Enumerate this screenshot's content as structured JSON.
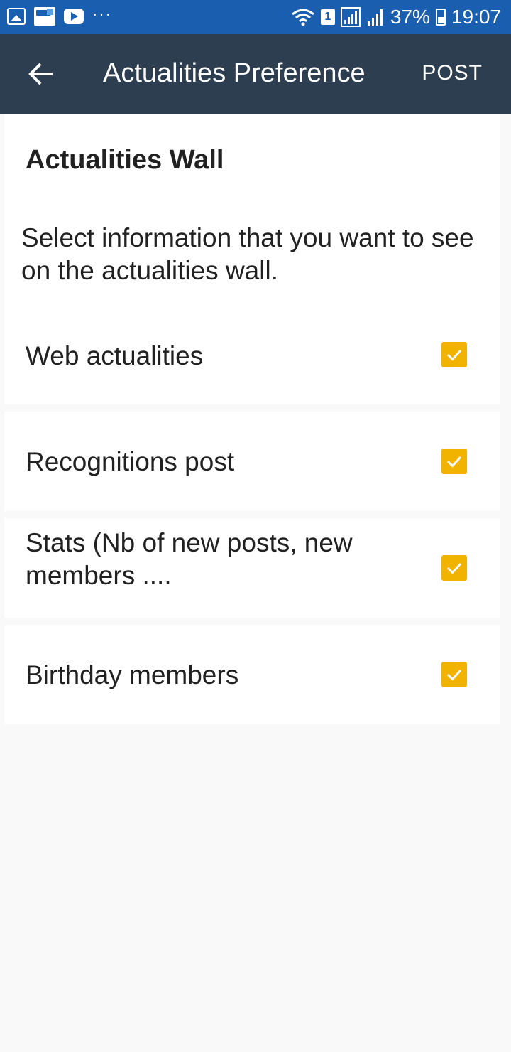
{
  "status_bar": {
    "icons_left": [
      "gallery-icon",
      "app-notification-icon",
      "youtube-icon"
    ],
    "more": "···",
    "sim": "1",
    "battery_percent": "37%",
    "time": "19:07"
  },
  "app_bar": {
    "title": "Actualities Preference",
    "post_label": "POST",
    "back_icon": "arrow-left-icon"
  },
  "section": {
    "title": "Actualities Wall",
    "description": "Select information that you want to see on the actualities wall."
  },
  "options": [
    {
      "label": "Web actualities",
      "checked": true
    },
    {
      "label": "Recognitions post",
      "checked": true
    },
    {
      "label": "Stats (Nb of new posts, new members ....",
      "checked": true
    },
    {
      "label": "Birthday members",
      "checked": true
    }
  ],
  "colors": {
    "status_bar": "#1a5eb0",
    "app_bar": "#2c3e50",
    "checkbox": "#f2b300",
    "background": "#f9f9f9"
  }
}
